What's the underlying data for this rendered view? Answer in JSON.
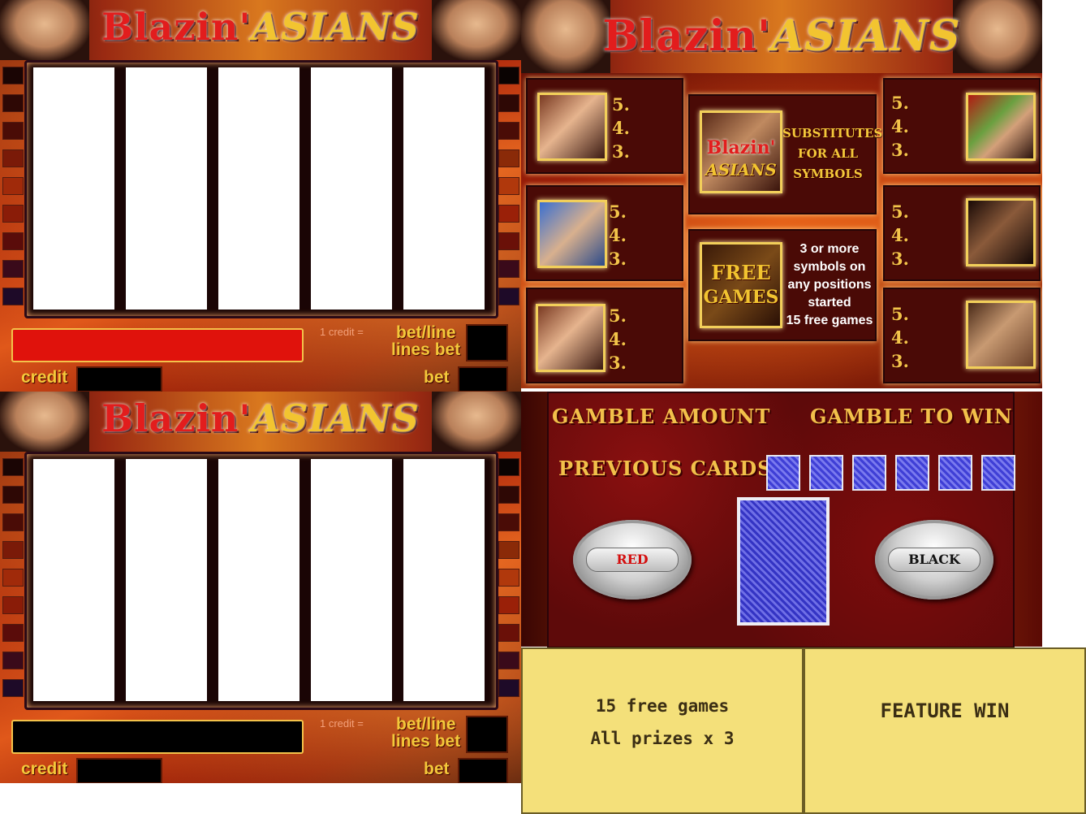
{
  "logo": {
    "part1": "Blazin'",
    "part2": "ASIANS"
  },
  "reel_panels": [
    {
      "credit_value_label": "1 credit =",
      "bet_line_label": "bet/line",
      "lines_bet_label": "lines bet",
      "credit_label": "credit",
      "bet_label": "bet",
      "message_bar_color": "#e0120c"
    },
    {
      "credit_value_label": "1 credit =",
      "bet_line_label": "bet/line",
      "lines_bet_label": "lines bet",
      "credit_label": "credit",
      "bet_label": "bet",
      "message_bar_color": "#000000"
    }
  ],
  "paytable": {
    "pays": [
      "5.",
      "4.",
      "3."
    ],
    "wild": {
      "logo1": "Blazin'",
      "logo2": "ASIANS",
      "line1": "SUBSTITUTES",
      "line2": "FOR ALL",
      "line3": "SYMBOLS"
    },
    "scatter": {
      "icon1": "FREE",
      "icon2": "GAMES",
      "line1": "3 or more",
      "line2": "symbols on",
      "line3": "any positions",
      "line4": "started",
      "line5": "15 free games"
    }
  },
  "gamble": {
    "amount_label": "GAMBLE AMOUNT",
    "to_win_label": "GAMBLE TO WIN",
    "previous_cards_label": "PREVIOUS CARDS",
    "red_button": "RED",
    "black_button": "BLACK",
    "previous_cards_count": 6
  },
  "free_games_box": {
    "line1": "15 free games",
    "line2": "All prizes x 3"
  },
  "feature_box": {
    "label": "FEATURE WIN"
  },
  "colors": {
    "accent_gold": "#f4c83a",
    "red": "#e0120c",
    "panel_yellow": "#f4e07a"
  }
}
